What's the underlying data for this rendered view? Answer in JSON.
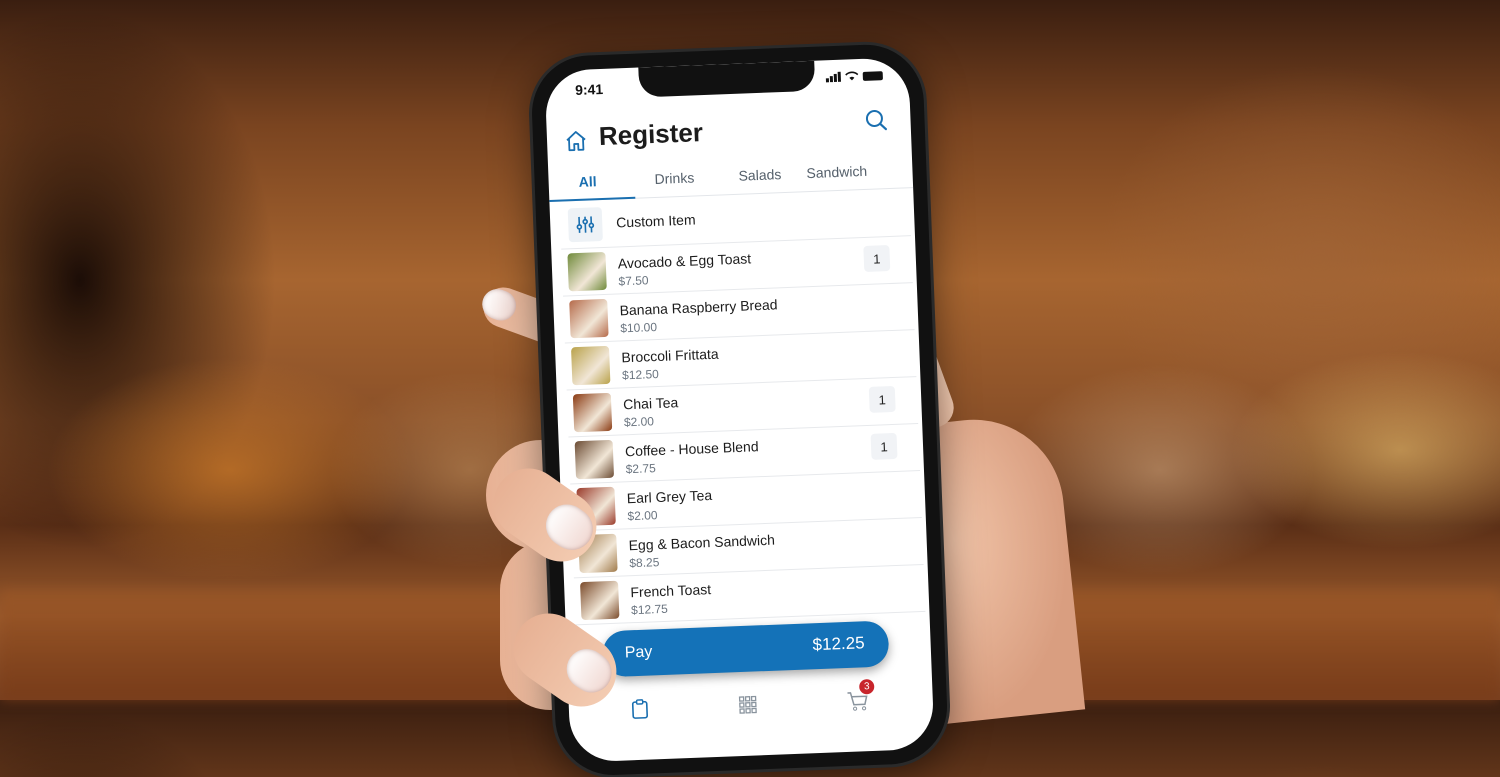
{
  "status_bar": {
    "time": "9:41"
  },
  "header": {
    "title": "Register",
    "home_icon": "home-icon",
    "search_icon": "search-icon"
  },
  "tabs": [
    {
      "label": "All",
      "active": true
    },
    {
      "label": "Drinks",
      "active": false
    },
    {
      "label": "Salads",
      "active": false
    },
    {
      "label": "Sandwich",
      "active": false
    }
  ],
  "custom_item": {
    "label": "Custom Item",
    "icon": "sliders-icon"
  },
  "items": [
    {
      "name": "Avocado & Egg Toast",
      "price": "$7.50",
      "qty": "1",
      "thumb_color": "#6f8a3a"
    },
    {
      "name": "Banana Raspberry Bread",
      "price": "$10.00",
      "qty": "",
      "thumb_color": "#b56a4a"
    },
    {
      "name": "Broccoli Frittata",
      "price": "$12.50",
      "qty": "",
      "thumb_color": "#b9a24a"
    },
    {
      "name": "Chai Tea",
      "price": "$2.00",
      "qty": "1",
      "thumb_color": "#8a3a12"
    },
    {
      "name": "Coffee - House Blend",
      "price": "$2.75",
      "qty": "1",
      "thumb_color": "#6a4a32"
    },
    {
      "name": "Earl Grey Tea",
      "price": "$2.00",
      "qty": "",
      "thumb_color": "#9a3a2a"
    },
    {
      "name": "Egg & Bacon Sandwich",
      "price": "$8.25",
      "qty": "",
      "thumb_color": "#a07a4a"
    },
    {
      "name": "French Toast",
      "price": "$12.75",
      "qty": "",
      "thumb_color": "#7a4a2a"
    }
  ],
  "pay": {
    "label": "Pay",
    "amount": "$12.25"
  },
  "bottom_nav": {
    "cart_count": "3"
  },
  "colors": {
    "accent": "#1472b8",
    "badge": "#c8252c"
  }
}
